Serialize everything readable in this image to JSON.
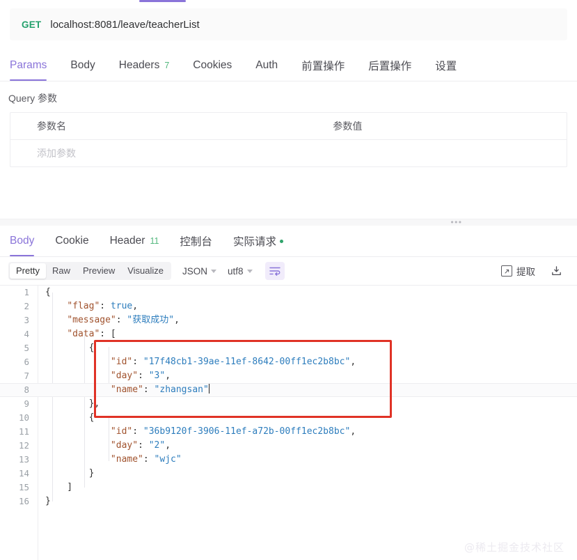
{
  "request": {
    "method": "GET",
    "url": "localhost:8081/leave/teacherList",
    "tabs": [
      {
        "label": "Params",
        "count": "",
        "active": true
      },
      {
        "label": "Body",
        "count": "",
        "active": false
      },
      {
        "label": "Headers",
        "count": "7",
        "active": false
      },
      {
        "label": "Cookies",
        "count": "",
        "active": false
      },
      {
        "label": "Auth",
        "count": "",
        "active": false
      },
      {
        "label": "前置操作",
        "count": "",
        "active": false
      },
      {
        "label": "后置操作",
        "count": "",
        "active": false
      },
      {
        "label": "设置",
        "count": "",
        "active": false
      }
    ],
    "query_label": "Query 参数",
    "param_table": {
      "headers": [
        "参数名",
        "参数值"
      ],
      "placeholder_row": "添加参数"
    }
  },
  "response": {
    "tabs": [
      {
        "label": "Body",
        "count": "",
        "active": true,
        "dot": false
      },
      {
        "label": "Cookie",
        "count": "",
        "active": false,
        "dot": false
      },
      {
        "label": "Header",
        "count": "11",
        "active": false,
        "dot": false
      },
      {
        "label": "控制台",
        "count": "",
        "active": false,
        "dot": false
      },
      {
        "label": "实际请求",
        "count": "",
        "active": false,
        "dot": true
      }
    ],
    "toolbar": {
      "view_modes": [
        "Pretty",
        "Raw",
        "Preview",
        "Visualize"
      ],
      "view_mode_active": "Pretty",
      "format_select": "JSON",
      "encoding_select": "utf8",
      "wrap_icon": "wrap-text-icon",
      "extract_label": "提取",
      "extract_icon": "extract-box-icon",
      "download_icon": "download-icon"
    },
    "code_lines": [
      {
        "n": "1",
        "text": "{"
      },
      {
        "n": "2",
        "text": "    \"flag\": true,"
      },
      {
        "n": "3",
        "text": "    \"message\": \"获取成功\","
      },
      {
        "n": "4",
        "text": "    \"data\": ["
      },
      {
        "n": "5",
        "text": "        {"
      },
      {
        "n": "6",
        "text": "            \"id\": \"17f48cb1-39ae-11ef-8642-00ff1ec2b8bc\","
      },
      {
        "n": "7",
        "text": "            \"day\": \"3\","
      },
      {
        "n": "8",
        "text": "            \"name\": \"zhangsan\""
      },
      {
        "n": "9",
        "text": "        },"
      },
      {
        "n": "10",
        "text": "        {"
      },
      {
        "n": "11",
        "text": "            \"id\": \"36b9120f-3906-11ef-a72b-00ff1ec2b8bc\","
      },
      {
        "n": "12",
        "text": "            \"day\": \"2\","
      },
      {
        "n": "13",
        "text": "            \"name\": \"wjc\""
      },
      {
        "n": "14",
        "text": "        }"
      },
      {
        "n": "15",
        "text": "    ]"
      },
      {
        "n": "16",
        "text": "}"
      }
    ],
    "json_payload": {
      "flag": true,
      "message": "获取成功",
      "data": [
        {
          "id": "17f48cb1-39ae-11ef-8642-00ff1ec2b8bc",
          "day": "3",
          "name": "zhangsan"
        },
        {
          "id": "36b9120f-3906-11ef-a72b-00ff1ec2b8bc",
          "day": "2",
          "name": "wjc"
        }
      ]
    },
    "active_line": "8",
    "annotation": {
      "type": "red-rectangle",
      "covers_lines": "5-9",
      "color": "#e03226"
    }
  },
  "watermark": "@稀土掘金技术社区",
  "colors": {
    "accent": "#8a74d9",
    "method_get": "#22a06b",
    "count_badge": "#53b87e",
    "annotation": "#e03226",
    "json_string": "#2d7dbd",
    "json_key": "#a0522d"
  }
}
